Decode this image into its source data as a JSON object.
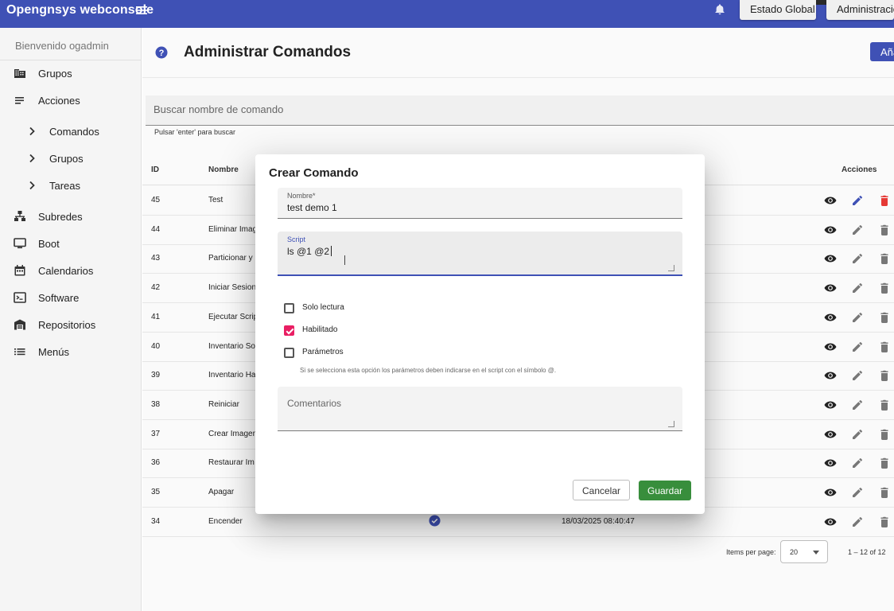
{
  "header": {
    "app_title": "Opengnsys webconsole",
    "buttons": [
      "Estado Global",
      "Administracion"
    ]
  },
  "sidebar": {
    "welcome": "Bienvenido ogadmin",
    "items": [
      {
        "label": "Grupos",
        "icon": "building-icon"
      },
      {
        "label": "Acciones",
        "icon": "list-icon"
      },
      {
        "label": "Comandos",
        "icon": "chevron-right-icon"
      },
      {
        "label": "Grupos",
        "icon": "chevron-right-icon"
      },
      {
        "label": "Tareas",
        "icon": "chevron-right-icon"
      },
      {
        "label": "Subredes",
        "icon": "network-icon"
      },
      {
        "label": "Boot",
        "icon": "monitor-icon"
      },
      {
        "label": "Calendarios",
        "icon": "calendar-icon"
      },
      {
        "label": "Software",
        "icon": "terminal-icon"
      },
      {
        "label": "Repositorios",
        "icon": "warehouse-icon"
      },
      {
        "label": "Menús",
        "icon": "menu-list-icon"
      }
    ]
  },
  "main": {
    "title": "Administrar Comandos",
    "add_button": "Añadir",
    "search_placeholder": "Buscar nombre de comando",
    "search_hint": "Pulsar 'enter' para buscar",
    "columns": {
      "id": "ID",
      "name": "Nombre",
      "actions": "Acciones"
    },
    "rows": [
      {
        "id": "45",
        "name": "Test"
      },
      {
        "id": "44",
        "name": "Eliminar Imag"
      },
      {
        "id": "43",
        "name": "Particionar y"
      },
      {
        "id": "42",
        "name": "Iniciar Sesion"
      },
      {
        "id": "41",
        "name": "Ejecutar Scrip"
      },
      {
        "id": "40",
        "name": "Inventario So"
      },
      {
        "id": "39",
        "name": "Inventario Ha"
      },
      {
        "id": "38",
        "name": "Reiniciar"
      },
      {
        "id": "37",
        "name": "Crear Imagen"
      },
      {
        "id": "36",
        "name": "Restaurar Im"
      },
      {
        "id": "35",
        "name": "Apagar"
      },
      {
        "id": "34",
        "name": "Encender",
        "date": "18/03/2025 08:40:47"
      }
    ],
    "pager": {
      "items_per_page_label": "Items per page:",
      "items_per_page": "20",
      "range": "1 – 12 of 12"
    }
  },
  "dialog": {
    "title": "Crear Comando",
    "name_label": "Nombre*",
    "name_value": "test demo 1",
    "script_label": "Script",
    "script_value": "ls @1 @2",
    "checkboxes": [
      {
        "label": "Solo lectura",
        "checked": false
      },
      {
        "label": "Habilitado",
        "checked": true
      },
      {
        "label": "Parámetros",
        "checked": false
      }
    ],
    "params_hint": "Si se selecciona esta opción los parámetros deben indicarse en el script con el símbolo @.",
    "comments_placeholder": "Comentarios",
    "cancel_label": "Cancelar",
    "save_label": "Guardar"
  },
  "colors": {
    "primary": "#3f51b5",
    "accent": "#e91e63",
    "save": "#388e3c",
    "delete_active": "#e53935"
  }
}
